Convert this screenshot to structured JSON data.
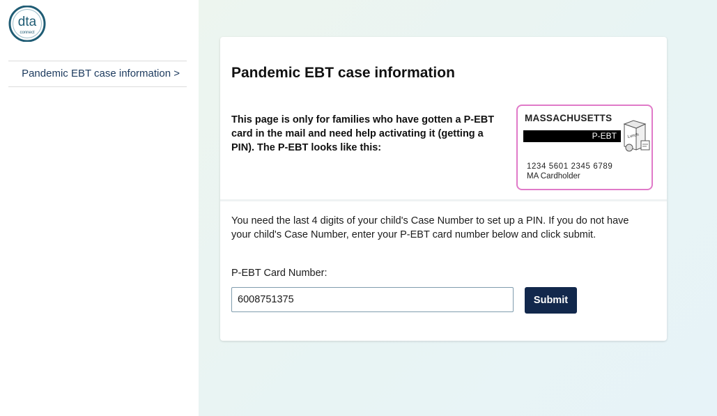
{
  "logo": {
    "text": "dta",
    "subtext": "connect"
  },
  "sidebar": {
    "items": [
      {
        "label": "Pandemic EBT case information >"
      }
    ]
  },
  "card": {
    "title": "Pandemic EBT case information",
    "intro": "This page is only for families who have gotten a P-EBT card in the mail and need help activating it (getting a PIN). The P-EBT looks like this:",
    "ebt_card": {
      "state": "MASSACHUSETTS",
      "program": "P-EBT",
      "art_label": "Lunch",
      "number": "1234 5601 2345 6789",
      "holder": "MA Cardholder",
      "border_color": "#e07ac8"
    },
    "help_text": "You need the last 4 digits of your child's Case Number to set up a PIN. If you do not have your child's Case Number, enter your P-EBT card number below and click submit.",
    "form": {
      "field_label": "P-EBT Card Number:",
      "field_value": "6008751375",
      "submit_label": "Submit"
    }
  },
  "colors": {
    "brand_navy": "#12284c",
    "link": "#1c3a5e",
    "card_accent": "#e07ac8",
    "logo_teal": "#1f5c74"
  }
}
